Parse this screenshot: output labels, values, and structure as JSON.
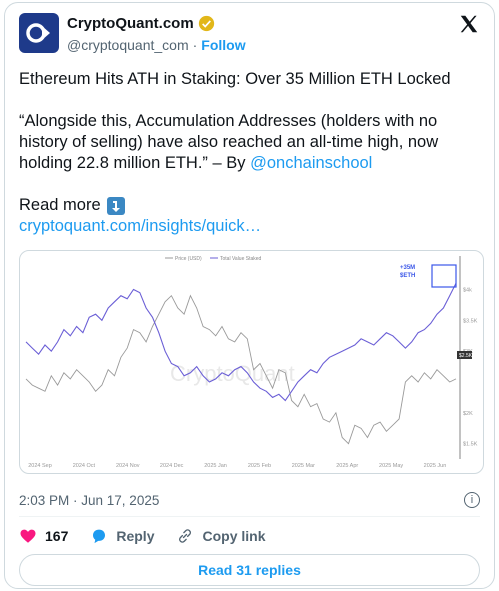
{
  "account": {
    "name": "CryptoQuant.com",
    "handle": "@cryptoquant_com",
    "separator": "·",
    "follow_label": "Follow"
  },
  "tweet": {
    "line1": "Ethereum Hits ATH in Staking: Over 35 Million ETH Locked",
    "quote": "“Alongside this, Accumulation Addresses (holders with no history of selling) have also reached an all-time high, now holding 22.8 million ETH.” – By ",
    "mention": "@onchainschool",
    "read_more": "Read more",
    "link": "cryptoquant.com/insights/quick…"
  },
  "chart_data": {
    "type": "line",
    "legend": [
      "Price (USD)",
      "Total Value Staked"
    ],
    "annotation": [
      "+35M",
      "$ETH"
    ],
    "watermark": "CryptoQuant",
    "x_ticks": [
      "2024 Sep",
      "2024 Oct",
      "2024 Nov",
      "2024 Dec",
      "2025 Jan",
      "2025 Feb",
      "2025 Mar",
      "2025 Apr",
      "2025 May",
      "2025 Jun"
    ],
    "y_ticks_right": [
      "$4k",
      "$3.5K",
      "$3K",
      "$2K",
      "$1.5K"
    ],
    "price_badge": "$2.5K",
    "series": [
      {
        "name": "Price (USD)",
        "color": "#9a9a9a",
        "values": [
          2550,
          2450,
          2400,
          2350,
          2600,
          2450,
          2650,
          2550,
          2700,
          2600,
          2500,
          2350,
          2450,
          2700,
          2600,
          2900,
          3050,
          3350,
          3300,
          3150,
          3400,
          3600,
          3800,
          3900,
          3700,
          3600,
          3900,
          3700,
          3400,
          3350,
          3250,
          3400,
          3200,
          3150,
          3300,
          3200,
          2700,
          2800,
          2600,
          2400,
          2700,
          2650,
          2200,
          2100,
          2300,
          2100,
          2150,
          1900,
          1850,
          2000,
          1600,
          1500,
          1800,
          1750,
          1600,
          1800,
          1850,
          1700,
          1800,
          1900,
          2500,
          2600,
          2500,
          2650,
          2550,
          2700,
          2600,
          2500,
          2550
        ]
      },
      {
        "name": "Total Value Staked",
        "color": "#6b5fd6",
        "values": [
          3150,
          3050,
          2950,
          3100,
          3000,
          3150,
          3350,
          3250,
          3400,
          3300,
          3550,
          3600,
          3500,
          3700,
          3800,
          3900,
          3850,
          4000,
          3950,
          3700,
          3550,
          3300,
          3000,
          2800,
          2750,
          2600,
          2650,
          2750,
          2600,
          2500,
          2550,
          2650,
          2600,
          2700,
          2750,
          2650,
          2500,
          2400,
          2350,
          2250,
          2300,
          2200,
          2350,
          2500,
          2600,
          2700,
          2650,
          2800,
          2900,
          2950,
          3000,
          3050,
          3100,
          3200,
          3150,
          3100,
          3200,
          3300,
          3250,
          3150,
          3050,
          3150,
          3300,
          3350,
          3450,
          3600,
          3700,
          3900,
          4100
        ]
      }
    ]
  },
  "meta": {
    "timestamp": "2:03 PM · Jun 17, 2025",
    "info_glyph": "i"
  },
  "actions": {
    "likes": "167",
    "reply": "Reply",
    "copy_link": "Copy link",
    "read_replies": "Read 31 replies"
  },
  "colors": {
    "accent": "#1d9bf0",
    "like": "#f91880",
    "brand": "#1e3a8a"
  }
}
